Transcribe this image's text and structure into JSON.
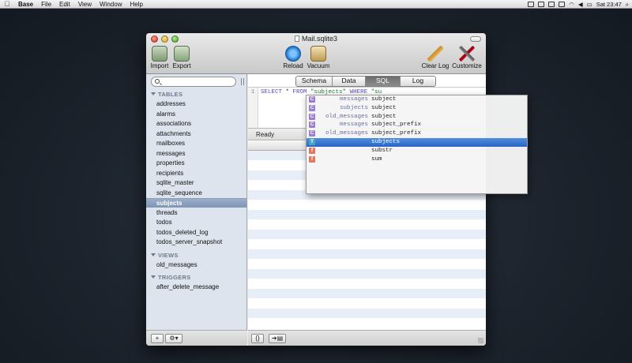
{
  "menubar": {
    "app": "Base",
    "menus": [
      "File",
      "Edit",
      "View",
      "Window",
      "Help"
    ],
    "clock": "Sat 23:47"
  },
  "window": {
    "title": "Mail.sqlite3",
    "toolbar": {
      "import": "Import",
      "export": "Export",
      "reload": "Reload",
      "vacuum": "Vacuum",
      "clear_log": "Clear Log",
      "customize": "Customize"
    }
  },
  "sidebar": {
    "search_placeholder": "",
    "tables_header": "TABLES",
    "tables": [
      "addresses",
      "alarms",
      "associations",
      "attachments",
      "mailboxes",
      "messages",
      "properties",
      "recipients",
      "sqlite_master",
      "sqlite_sequence",
      "subjects",
      "threads",
      "todos",
      "todos_deleted_log",
      "todos_server_snapshot"
    ],
    "selected": "subjects",
    "views_header": "VIEWS",
    "views": [
      "old_messages"
    ],
    "triggers_header": "TRIGGERS",
    "triggers": [
      "after_delete_message"
    ],
    "add_label": "+",
    "gear_label": "⚙▾"
  },
  "tabs": [
    "Schema",
    "Data",
    "SQL",
    "Log"
  ],
  "active_tab": "SQL",
  "editor": {
    "line_number": "1",
    "sql_keyword1": "SELECT",
    "sql_star": " * ",
    "sql_keyword2": "FROM",
    "sql_table": " \"subjects\" ",
    "sql_keyword3": "WHERE",
    "sql_partial": " \"su"
  },
  "status": "Ready",
  "bottom_buttons": [
    "{}",
    "➔▤"
  ],
  "autocomplete": [
    {
      "type": "C",
      "context": "messages",
      "name": "subject"
    },
    {
      "type": "C",
      "context": "subjects",
      "name": "subject"
    },
    {
      "type": "C",
      "context": "old_messages",
      "name": "subject"
    },
    {
      "type": "C",
      "context": "messages",
      "name": "subject_prefix"
    },
    {
      "type": "C",
      "context": "old_messages",
      "name": "subject_prefix"
    },
    {
      "type": "T",
      "context": "",
      "name": "subjects",
      "selected": true
    },
    {
      "type": "f",
      "context": "",
      "name": "substr"
    },
    {
      "type": "f",
      "context": "",
      "name": "sum"
    }
  ],
  "colors": {
    "selection": "#2865c4",
    "sidebar_bg": "#dde4ed",
    "column_badge": "#9a7ecf",
    "table_badge": "#4aa7c4",
    "function_badge": "#e2775d"
  }
}
